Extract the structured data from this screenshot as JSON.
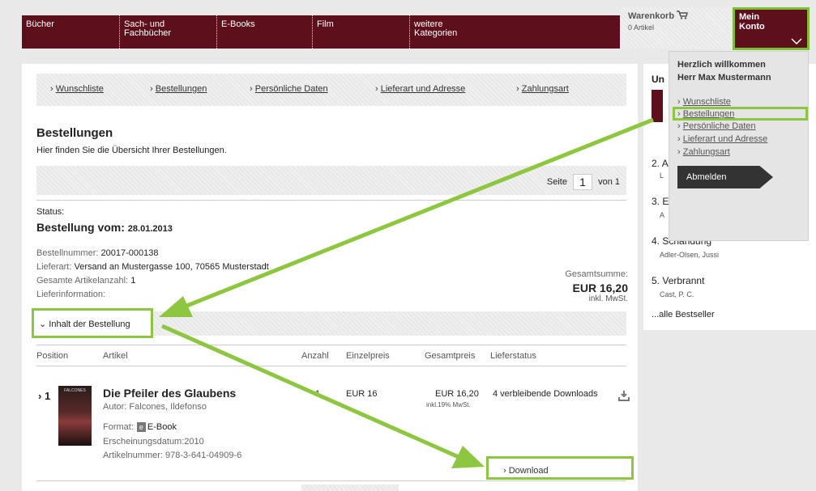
{
  "nav": {
    "items": [
      {
        "label": "Bücher"
      },
      {
        "label": "Sach- und Fachbücher"
      },
      {
        "label": "E-Books"
      },
      {
        "label": "Film"
      },
      {
        "label": "weitere Kategorien"
      }
    ]
  },
  "cart": {
    "title": "Warenkorb",
    "count": "0 Artikel",
    "icon": "cart-icon"
  },
  "account": {
    "label": "Mein\nKonto",
    "icon": "chevron-down-icon"
  },
  "subnav": [
    "Wunschliste",
    "Bestellungen",
    "Persönliche Daten",
    "Lieferart und Adresse",
    "Zahlungsart"
  ],
  "page": {
    "title": "Bestellungen",
    "description": "Hier finden Sie die Übersicht Ihrer Bestellungen."
  },
  "pagination": {
    "label": "Seite",
    "current": "1",
    "of": "von 1"
  },
  "order": {
    "status_label": "Status:",
    "date_label": "Bestellung vom:",
    "date": "28.01.2013",
    "number_label": "Bestellnummer:",
    "number": "20017-000138",
    "delivery_label": "Lieferart:",
    "delivery": "Versand an Mustergasse 100, 70565 Musterstadt",
    "items_label": "Gesamte Artikelanzahl:",
    "items_count": "1",
    "info_label": "Lieferinformation:",
    "total_label": "Gesamtsumme:",
    "total": "EUR 16,20",
    "total_tax": "inkl. MwSt."
  },
  "contents": {
    "label": "Inhalt der Bestellung"
  },
  "table": {
    "headers": [
      "Position",
      "Artikel",
      "Anzahl",
      "Einzelpreis",
      "Gesamtpreis",
      "Lieferstatus"
    ],
    "row": {
      "position": "1",
      "title": "Die Pfeiler des Glaubens",
      "author_label": "Autor:",
      "author": "Falcones, Ildefonso",
      "format_label": "Format:",
      "format": "E-Book",
      "date_label": "Erscheinungsdatum:",
      "date": "2010",
      "artnr_label": "Artikelnummer:",
      "artnr": "978-3-641-04909-6",
      "qty": "1",
      "unit_price": "EUR 16",
      "total_price": "EUR 16,20",
      "total_tax": "inkl.19% MwSt.",
      "status": "4  verbleibende Downloads",
      "cover_text": "FALCONES"
    },
    "download": "Download"
  },
  "bestseller": {
    "title": "Un",
    "items": [
      {
        "rank": "2.",
        "title": "A",
        "author": "L"
      },
      {
        "rank": "3.",
        "title": "E",
        "author": "A"
      },
      {
        "rank": "4.",
        "title": "Schändung",
        "author": "Adler-Olsen, Jussi"
      },
      {
        "rank": "5.",
        "title": "Verbrannt",
        "author": "Cast, P. C."
      }
    ],
    "more": "...alle Bestseller"
  },
  "dropdown": {
    "welcome": "Herzlich willkommen",
    "name": "Herr  Max  Mustermann",
    "links": [
      "Wunschliste",
      "Bestellungen",
      "Persönliche Daten",
      "Lieferart und Adresse",
      "Zahlungsart"
    ],
    "logout": "Abmelden"
  },
  "colors": {
    "nav_bg": "#5e0f1c",
    "highlight": "#8dc63f",
    "logout_bg": "#333333"
  }
}
